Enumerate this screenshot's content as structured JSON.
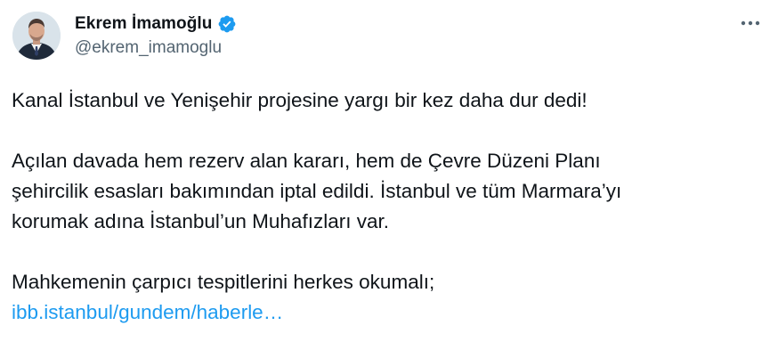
{
  "user": {
    "display_name": "Ekrem İmamoğlu",
    "handle": "@ekrem_imamoglu",
    "verified_icon": "verified-badge-icon",
    "avatar_icon": "profile-avatar"
  },
  "more_icon": "more-options-icon",
  "tweet": {
    "p1": "Kanal İstanbul ve Yenişehir projesine yargı bir kez daha dur dedi!",
    "p2_l1": "Açılan davada hem rezerv alan kararı, hem de Çevre Düzeni Planı",
    "p2_l2": "şehircilik esasları bakımından iptal edildi. İstanbul ve tüm Marmara’yı",
    "p2_l3": "korumak adına İstanbul’un Muhafızları var.",
    "p3": "Mahkemenin çarpıcı tespitlerini herkes okumalı;",
    "link": "ibb.istanbul/gundem/haberle…"
  },
  "colors": {
    "text": "#0f1419",
    "secondary": "#536471",
    "link": "#1d9bf0",
    "verified": "#1d9bf0"
  }
}
